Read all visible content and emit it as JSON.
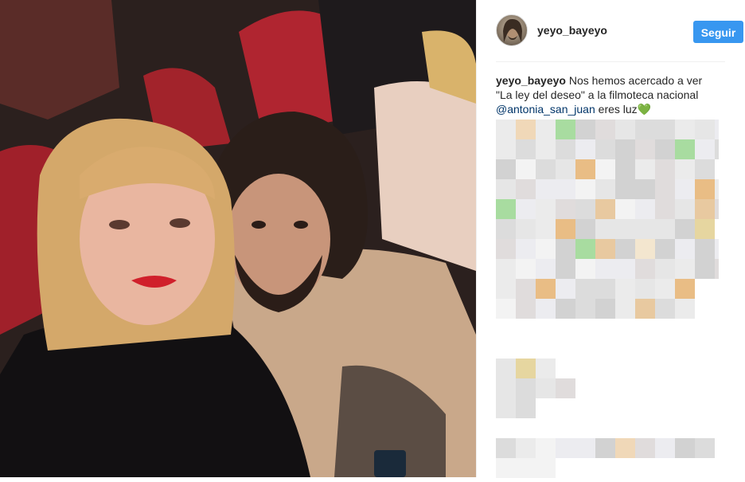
{
  "post": {
    "username": "yeyo_bayeyo",
    "follow_label": "Seguir",
    "caption_user": "yeyo_bayeyo",
    "caption_line1": " Nos hemos acercado a ver",
    "caption_line2": "\"La ley del deseo\" a la filmoteca nacional",
    "caption_mention": "@antonia_san_juan",
    "caption_tail": " eres luz",
    "caption_emoji": "💚"
  },
  "icons": {
    "avatar": "profile-avatar",
    "heart": "green-heart-emoji"
  },
  "colors": {
    "follow_button": "#3897f0",
    "mention": "#003569",
    "username": "#262626"
  }
}
